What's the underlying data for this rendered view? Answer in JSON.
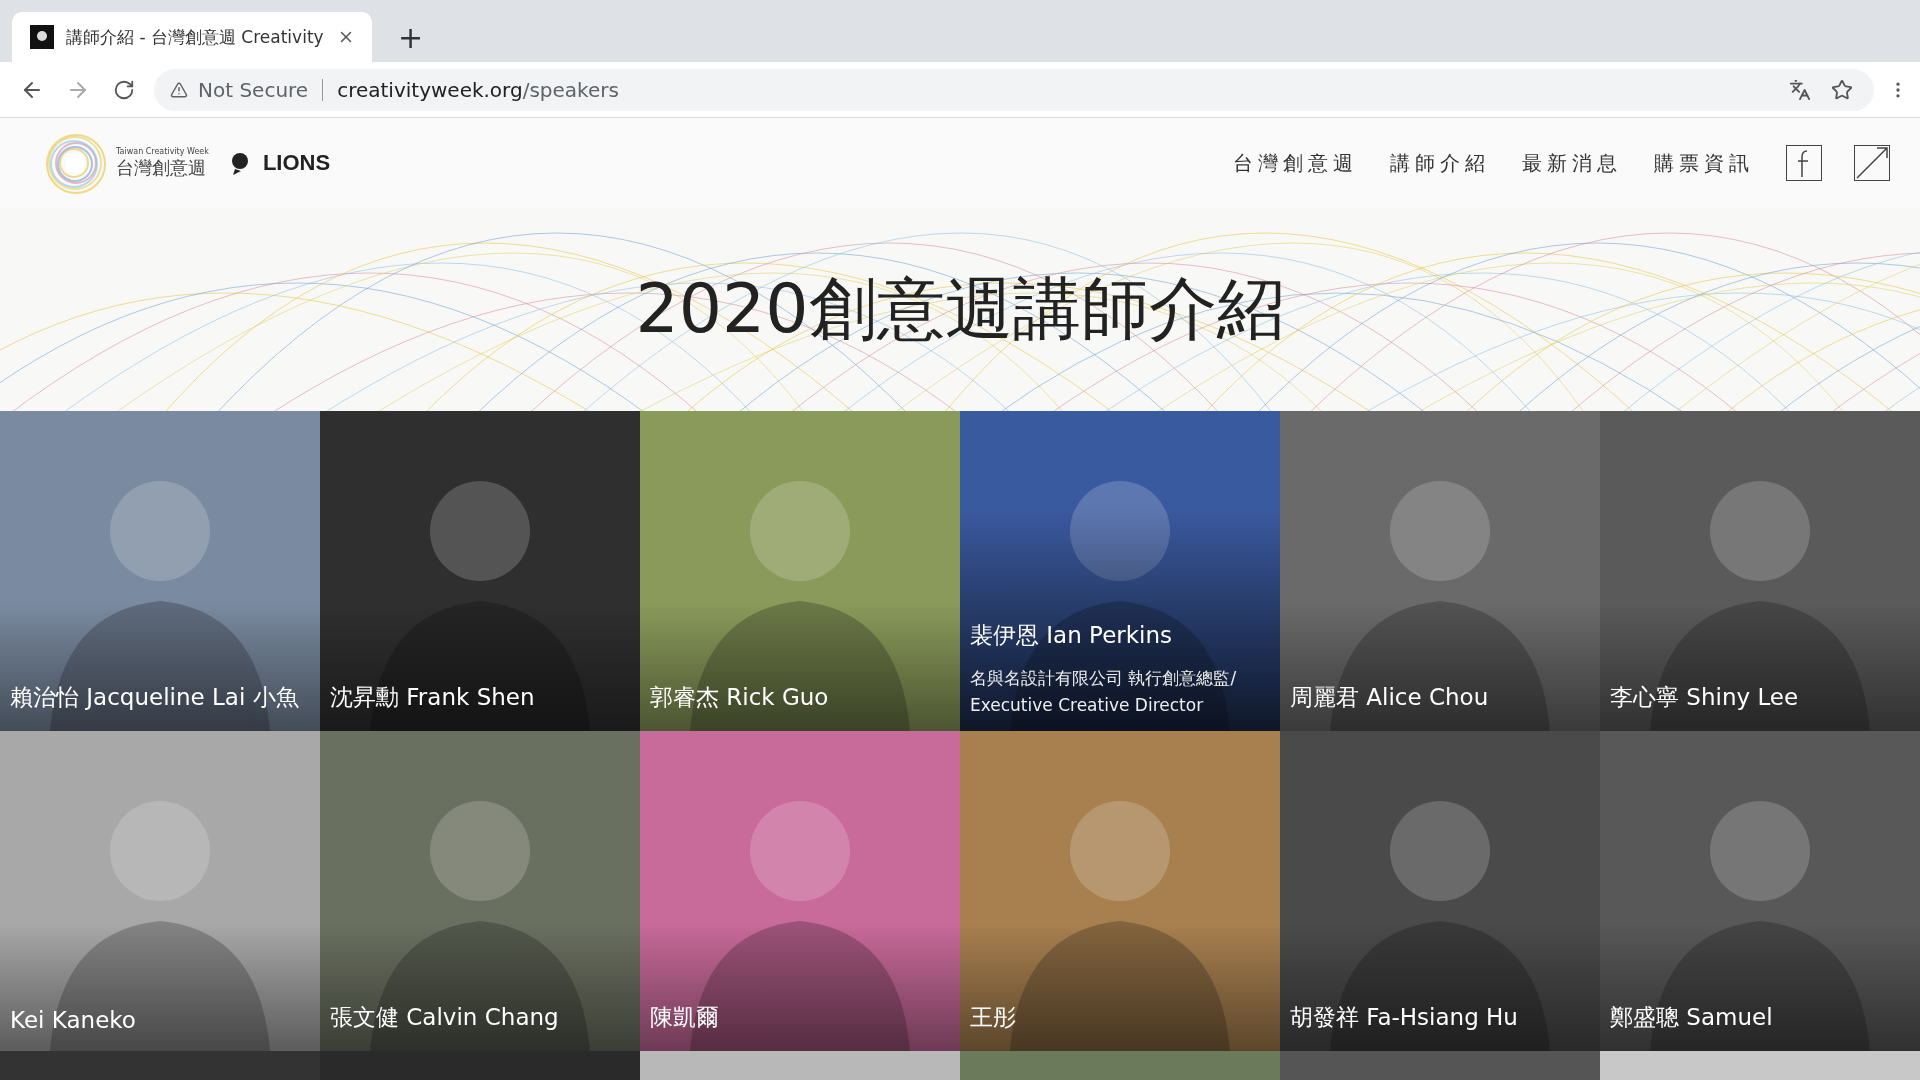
{
  "browser": {
    "tab_title": "講師介紹 - 台灣創意週 Creativity",
    "new_tab": "+",
    "security": "Not Secure",
    "url_host": "creativityweek.org",
    "url_path": "/speakers"
  },
  "site": {
    "logo_en": "Taiwan Creativity Week",
    "logo_zh": "台灣創意週",
    "partner": "LIONS",
    "nav": [
      {
        "label": "台灣創意週"
      },
      {
        "label": "講師介紹"
      },
      {
        "label": "最新消息"
      },
      {
        "label": "購票資訊"
      }
    ]
  },
  "page_title": "2020創意週講師介紹",
  "speakers": [
    {
      "name": "賴治怡 Jacqueline Lai 小魚",
      "highlighted": false
    },
    {
      "name": "沈昇勳 Frank Shen",
      "highlighted": false
    },
    {
      "name": "郭睿杰 Rick Guo",
      "highlighted": false
    },
    {
      "name": "裴伊恩 Ian Perkins",
      "highlighted": true,
      "role": "名與名設計有限公司 執行創意總監/ Executive Creative Director"
    },
    {
      "name": "周麗君 Alice Chou",
      "highlighted": false
    },
    {
      "name": "李心寧 Shiny Lee",
      "highlighted": false
    },
    {
      "name": "Kei Kaneko",
      "highlighted": false
    },
    {
      "name": "張文健 Calvin Chang",
      "highlighted": false
    },
    {
      "name": "陳凱爾",
      "highlighted": false
    },
    {
      "name": "王彤",
      "highlighted": false
    },
    {
      "name": "胡發祥 Fa-Hsiang Hu",
      "highlighted": false
    },
    {
      "name": "鄭盛聰 Samuel",
      "highlighted": false
    }
  ]
}
